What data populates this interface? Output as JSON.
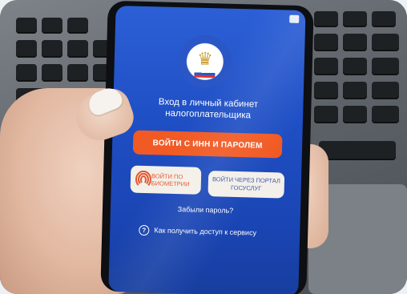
{
  "app": {
    "login_title": "Вход в личный кабинет налогоплательщика",
    "btn_inn": "ВОЙТИ С ИНН И ПАРОЛЕМ",
    "btn_biometrics": "ВОЙТИ ПО БИОМЕТРИИ",
    "btn_gosuslugi": "ВОЙТИ ЧЕРЕЗ ПОРТАЛ ГОСУСЛУГ",
    "forgot_password": "Забыли пароль?",
    "access_help": "Как получить доступ к сервису",
    "help_icon_glyph": "?"
  },
  "colors": {
    "screen_blue": "#2253c8",
    "accent_orange": "#f15a24",
    "secondary_button": "#f3efe9"
  },
  "icons": {
    "logo": "tax-service-emblem-icon",
    "fingerprint": "fingerprint-icon",
    "help": "question-circle-icon",
    "status": "notification-icon"
  }
}
